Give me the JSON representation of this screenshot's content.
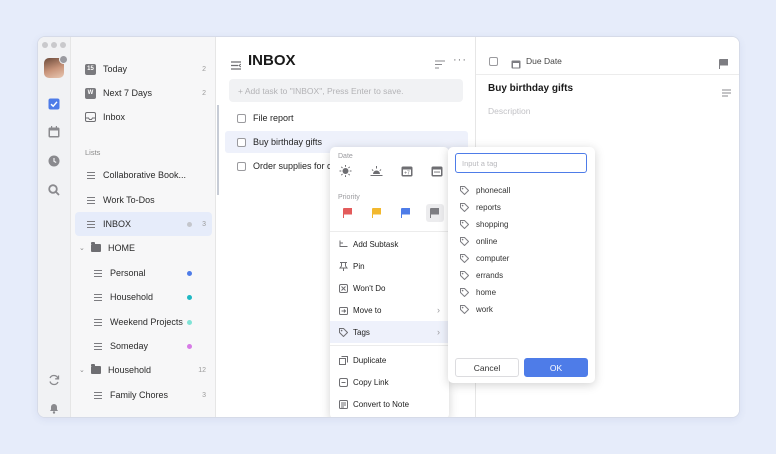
{
  "sidebar": {
    "smart_lists": [
      {
        "label": "Today",
        "count": "2",
        "badge": "15"
      },
      {
        "label": "Next 7 Days",
        "count": "2",
        "badge": "W"
      },
      {
        "label": "Inbox",
        "count": ""
      }
    ],
    "section_title": "Lists",
    "lists": [
      {
        "label": "Collaborative Book...",
        "count": ""
      },
      {
        "label": "Work To-Dos",
        "count": ""
      },
      {
        "label": "INBOX",
        "count": "3"
      }
    ],
    "folder_home": "HOME",
    "home_lists": [
      {
        "label": "Personal",
        "color": "#4e7ce8"
      },
      {
        "label": "Household",
        "color": "#1fb8c3"
      },
      {
        "label": "Weekend Projects",
        "color": "#7fe3d6"
      },
      {
        "label": "Someday",
        "color": "#d77be6"
      }
    ],
    "folder_household": "Household",
    "folder_household_count": "12",
    "household_lists": [
      {
        "label": "Family Chores",
        "count": "3"
      }
    ]
  },
  "main": {
    "title": "INBOX",
    "add_task_placeholder": "+ Add task to \"INBOX\", Press Enter to save.",
    "tasks": [
      {
        "label": "File report"
      },
      {
        "label": "Buy birthday gifts"
      },
      {
        "label": "Order supplies for ca"
      }
    ]
  },
  "detail": {
    "due_date_label": "Due Date",
    "title": "Buy birthday gifts",
    "description_placeholder": "Description"
  },
  "context_menu": {
    "date_label": "Date",
    "priority_label": "Priority",
    "priority_colors": [
      "#e35b5b",
      "#f2b82e",
      "#4e7ce8",
      "#7d7d82"
    ],
    "items": [
      {
        "label": "Add Subtask"
      },
      {
        "label": "Pin"
      },
      {
        "label": "Won't Do"
      },
      {
        "label": "Move to"
      },
      {
        "label": "Tags"
      },
      {
        "label": "Duplicate"
      },
      {
        "label": "Copy Link"
      },
      {
        "label": "Convert to Note"
      }
    ]
  },
  "tag_popup": {
    "input_placeholder": "Input a tag",
    "tags": [
      "phonecall",
      "reports",
      "shopping",
      "online",
      "computer",
      "errands",
      "home",
      "work"
    ],
    "cancel_label": "Cancel",
    "ok_label": "OK"
  }
}
